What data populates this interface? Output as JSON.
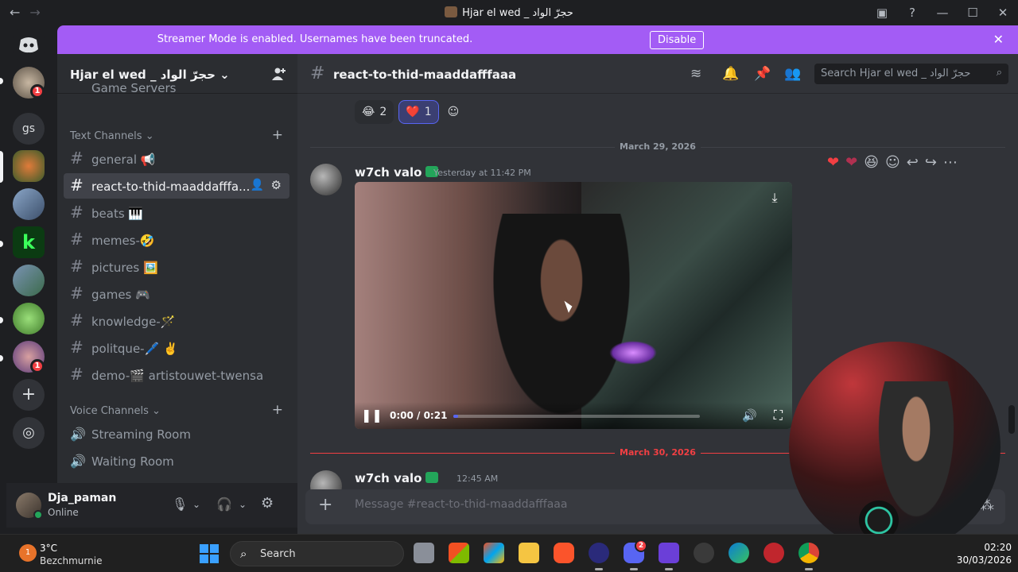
{
  "window": {
    "title": "Hjar el wed _ حجرّ الواد"
  },
  "banner": {
    "message": "Streamer Mode is enabled. Usernames have been truncated.",
    "disable_label": "Disable"
  },
  "server": {
    "name": "Hjar el wed _ حجرّ الواد",
    "partial_channel": "Game Servers"
  },
  "guild_badges": {
    "first": "1",
    "last": "1",
    "dm_label": "gs"
  },
  "sidebar": {
    "text_category": "Text Channels",
    "text_channels": [
      {
        "label": "general 📢"
      },
      {
        "label": "react-to-thid-maaddafffa..."
      },
      {
        "label": "beats 🎹"
      },
      {
        "label": "memes-🤣"
      },
      {
        "label": "pictures 🖼️"
      },
      {
        "label": "games 🎮"
      },
      {
        "label": "knowledge-🪄"
      },
      {
        "label": "politque-🖊️ ✌️"
      },
      {
        "label": "demo-🎬 artistouwet-twensa"
      }
    ],
    "voice_category": "Voice Channels",
    "voice_channels": [
      {
        "label": "Streaming Room"
      },
      {
        "label": "Waiting Room"
      }
    ]
  },
  "user": {
    "name": "Dja_paman",
    "status": "Online"
  },
  "channel": {
    "name": "react-to-thid-maaddafffaaa",
    "search_placeholder": "Search Hjar el wed _ حجرّ الواد"
  },
  "reactions": [
    {
      "emoji": "😂",
      "count": "2"
    },
    {
      "emoji": "❤️",
      "count": "1"
    }
  ],
  "dividers": {
    "first": "March 29, 2026",
    "second": "March 30, 2026"
  },
  "messages": [
    {
      "author": "w7ch valo",
      "timestamp": "Yesterday at 11:42 PM"
    },
    {
      "author": "w7ch valo",
      "timestamp": "12:45 AM"
    }
  ],
  "video": {
    "time": "0:00 / 0:21",
    "progress": 0.0
  },
  "composer": {
    "placeholder": "Message #react-to-thid-maaddafffaaa"
  },
  "taskbar": {
    "temperature": "3°C",
    "location": "Bezchmurnie",
    "search_label": "Search",
    "time": "02:20",
    "date": "30/03/2026",
    "weather_badge": "1",
    "discord_badge": "2"
  },
  "colors": {
    "banner": "#a35cf5",
    "accent": "#5865f2",
    "online": "#23a55a",
    "red": "#f23f43"
  }
}
